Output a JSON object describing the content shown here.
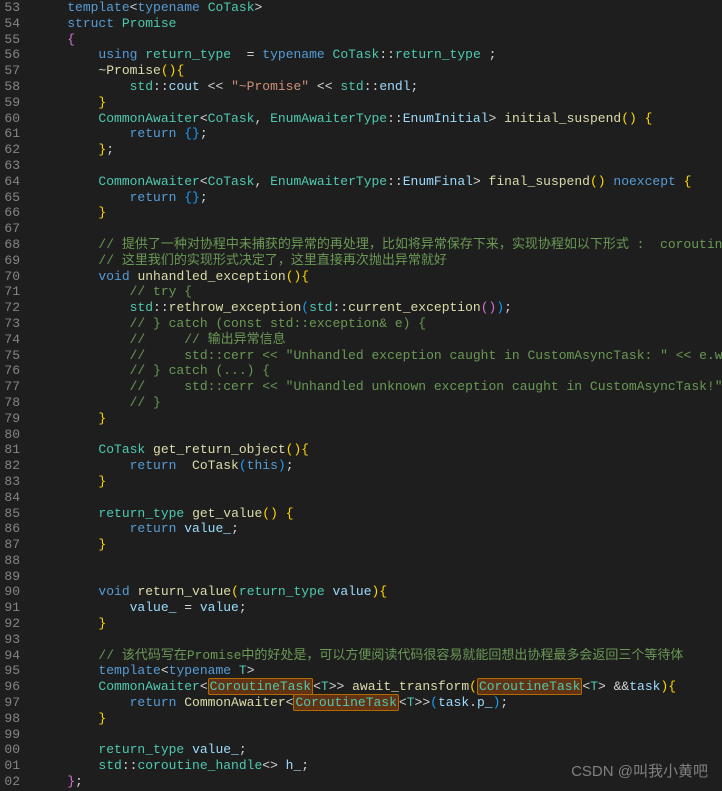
{
  "watermark": "CSDN @叫我小黄吧",
  "lines": [
    {
      "n": "53",
      "t": "    template<typename CoTask>",
      "tok": [
        [
          "    ",
          ""
        ],
        [
          "template",
          "kw"
        ],
        [
          "<",
          "op"
        ],
        [
          "typename",
          "kw"
        ],
        [
          " ",
          ""
        ],
        [
          "CoTask",
          "type"
        ],
        [
          ">",
          "op"
        ]
      ]
    },
    {
      "n": "54",
      "t": "    struct Promise",
      "tok": [
        [
          "    ",
          ""
        ],
        [
          "struct",
          "kw"
        ],
        [
          " ",
          ""
        ],
        [
          "Promise",
          "type"
        ]
      ]
    },
    {
      "n": "55",
      "t": "    {",
      "tok": [
        [
          "    ",
          ""
        ],
        [
          "{",
          "brace"
        ]
      ]
    },
    {
      "n": "56",
      "t": "        using return_type  = typename CoTask::return_type ;",
      "tok": [
        [
          "        ",
          ""
        ],
        [
          "using",
          "kw"
        ],
        [
          " ",
          ""
        ],
        [
          "return_type",
          "type"
        ],
        [
          "  = ",
          ""
        ],
        [
          "typename",
          "kw"
        ],
        [
          " ",
          ""
        ],
        [
          "CoTask",
          "type"
        ],
        [
          "::",
          ""
        ],
        [
          "return_type",
          "type"
        ],
        [
          " ;",
          ""
        ]
      ]
    },
    {
      "n": "57",
      "t": "        ~Promise(){",
      "tok": [
        [
          "        ~",
          ""
        ],
        [
          "Promise",
          "fn"
        ],
        [
          "()",
          "brace2"
        ],
        [
          "{",
          "brace2"
        ]
      ]
    },
    {
      "n": "58",
      "t": "            std::cout << \"~Promise\" << std::endl;",
      "tok": [
        [
          "            ",
          ""
        ],
        [
          "std",
          "type"
        ],
        [
          "::",
          ""
        ],
        [
          "cout",
          "var"
        ],
        [
          " << ",
          ""
        ],
        [
          "\"~Promise\"",
          "str"
        ],
        [
          " << ",
          ""
        ],
        [
          "std",
          "type"
        ],
        [
          "::",
          ""
        ],
        [
          "endl",
          "var"
        ],
        [
          ";",
          ""
        ]
      ]
    },
    {
      "n": "59",
      "t": "        }",
      "tok": [
        [
          "        ",
          ""
        ],
        [
          "}",
          "brace2"
        ]
      ]
    },
    {
      "n": "60",
      "t": "        CommonAwaiter<CoTask, EnumAwaiterType::EnumInitial> initial_suspend() {",
      "tok": [
        [
          "        ",
          ""
        ],
        [
          "CommonAwaiter",
          "type"
        ],
        [
          "<",
          "op"
        ],
        [
          "CoTask",
          "type"
        ],
        [
          ", ",
          ""
        ],
        [
          "EnumAwaiterType",
          "type"
        ],
        [
          "::",
          ""
        ],
        [
          "EnumInitial",
          "var"
        ],
        [
          "> ",
          ""
        ],
        [
          "initial_suspend",
          "fn"
        ],
        [
          "()",
          "brace2"
        ],
        [
          " ",
          ""
        ],
        [
          "{",
          "brace2"
        ]
      ]
    },
    {
      "n": "61",
      "t": "            return {};",
      "tok": [
        [
          "            ",
          ""
        ],
        [
          "return",
          "kw"
        ],
        [
          " ",
          ""
        ],
        [
          "{}",
          "brace3"
        ],
        [
          ";",
          ""
        ]
      ]
    },
    {
      "n": "62",
      "t": "        };",
      "tok": [
        [
          "        ",
          ""
        ],
        [
          "}",
          "brace2"
        ],
        [
          ";",
          ""
        ]
      ]
    },
    {
      "n": "63",
      "t": "",
      "tok": []
    },
    {
      "n": "64",
      "t": "        CommonAwaiter<CoTask, EnumAwaiterType::EnumFinal> final_suspend() noexcept {",
      "tok": [
        [
          "        ",
          ""
        ],
        [
          "CommonAwaiter",
          "type"
        ],
        [
          "<",
          "op"
        ],
        [
          "CoTask",
          "type"
        ],
        [
          ", ",
          ""
        ],
        [
          "EnumAwaiterType",
          "type"
        ],
        [
          "::",
          ""
        ],
        [
          "EnumFinal",
          "var"
        ],
        [
          "> ",
          ""
        ],
        [
          "final_suspend",
          "fn"
        ],
        [
          "()",
          "brace2"
        ],
        [
          " ",
          ""
        ],
        [
          "noexcept",
          "kw"
        ],
        [
          " ",
          ""
        ],
        [
          "{",
          "brace2"
        ]
      ]
    },
    {
      "n": "65",
      "t": "            return {};",
      "tok": [
        [
          "            ",
          ""
        ],
        [
          "return",
          "kw"
        ],
        [
          " ",
          ""
        ],
        [
          "{}",
          "brace3"
        ],
        [
          ";",
          ""
        ]
      ]
    },
    {
      "n": "66",
      "t": "        }",
      "tok": [
        [
          "        ",
          ""
        ],
        [
          "}",
          "brace2"
        ]
      ]
    },
    {
      "n": "67",
      "t": "",
      "tok": []
    },
    {
      "n": "68",
      "t": "        // 提供了一种对协程中未捕获的异常的再处理，比如将异常保存下来，实现协程如以下形式 :  coroutine().get().catch()",
      "tok": [
        [
          "        ",
          ""
        ],
        [
          "// 提供了一种对协程中未捕获的异常的再处理，比如将异常保存下来，实现协程如以下形式 :  coroutine().get().catch()",
          "cmt"
        ]
      ]
    },
    {
      "n": "69",
      "t": "        // 这里我们的实现形式决定了，这里直接再次抛出异常就好",
      "tok": [
        [
          "        ",
          ""
        ],
        [
          "// 这里我们的实现形式决定了，这里直接再次抛出异常就好",
          "cmt"
        ]
      ]
    },
    {
      "n": "70",
      "t": "        void unhandled_exception(){",
      "tok": [
        [
          "        ",
          ""
        ],
        [
          "void",
          "kw"
        ],
        [
          " ",
          ""
        ],
        [
          "unhandled_exception",
          "fn"
        ],
        [
          "()",
          "brace2"
        ],
        [
          "{",
          "brace2"
        ]
      ]
    },
    {
      "n": "71",
      "t": "            // try {",
      "tok": [
        [
          "            ",
          ""
        ],
        [
          "// try {",
          "cmt"
        ]
      ]
    },
    {
      "n": "72",
      "t": "            std::rethrow_exception(std::current_exception());",
      "tok": [
        [
          "            ",
          ""
        ],
        [
          "std",
          "type"
        ],
        [
          "::",
          ""
        ],
        [
          "rethrow_exception",
          "fn"
        ],
        [
          "(",
          "brace3"
        ],
        [
          "std",
          "type"
        ],
        [
          "::",
          ""
        ],
        [
          "current_exception",
          "fn"
        ],
        [
          "()",
          "brace"
        ],
        [
          ")",
          "brace3"
        ],
        [
          ";",
          ""
        ]
      ]
    },
    {
      "n": "73",
      "t": "            // } catch (const std::exception& e) {",
      "tok": [
        [
          "            ",
          ""
        ],
        [
          "// } catch (const std::exception& e) {",
          "cmt"
        ]
      ]
    },
    {
      "n": "74",
      "t": "            //     // 输出异常信息",
      "tok": [
        [
          "            ",
          ""
        ],
        [
          "//     // 输出异常信息",
          "cmt"
        ]
      ]
    },
    {
      "n": "75",
      "t": "            //     std::cerr << \"Unhandled exception caught in CustomAsyncTask: \" << e.what() << std::endl;",
      "tok": [
        [
          "            ",
          ""
        ],
        [
          "//     std::cerr << \"Unhandled exception caught in CustomAsyncTask: \" << e.what() << std::endl;",
          "cmt"
        ]
      ]
    },
    {
      "n": "76",
      "t": "            // } catch (...) {",
      "tok": [
        [
          "            ",
          ""
        ],
        [
          "// } catch (...) {",
          "cmt"
        ]
      ]
    },
    {
      "n": "77",
      "t": "            //     std::cerr << \"Unhandled unknown exception caught in CustomAsyncTask!\" << std::endl;",
      "tok": [
        [
          "            ",
          ""
        ],
        [
          "//     std::cerr << \"Unhandled unknown exception caught in CustomAsyncTask!\" << std::endl;",
          "cmt"
        ]
      ]
    },
    {
      "n": "78",
      "t": "            // }",
      "tok": [
        [
          "            ",
          ""
        ],
        [
          "// }",
          "cmt"
        ]
      ]
    },
    {
      "n": "79",
      "t": "        }",
      "tok": [
        [
          "        ",
          ""
        ],
        [
          "}",
          "brace2"
        ]
      ]
    },
    {
      "n": "80",
      "t": "",
      "tok": []
    },
    {
      "n": "81",
      "t": "        CoTask get_return_object(){",
      "tok": [
        [
          "        ",
          ""
        ],
        [
          "CoTask",
          "type"
        ],
        [
          " ",
          ""
        ],
        [
          "get_return_object",
          "fn"
        ],
        [
          "()",
          "brace2"
        ],
        [
          "{",
          "brace2"
        ]
      ]
    },
    {
      "n": "82",
      "t": "            return  CoTask(this);",
      "tok": [
        [
          "            ",
          ""
        ],
        [
          "return",
          "kw"
        ],
        [
          "  ",
          ""
        ],
        [
          "CoTask",
          "fn"
        ],
        [
          "(",
          "brace3"
        ],
        [
          "this",
          "kw"
        ],
        [
          ")",
          "brace3"
        ],
        [
          ";",
          ""
        ]
      ]
    },
    {
      "n": "83",
      "t": "        }",
      "tok": [
        [
          "        ",
          ""
        ],
        [
          "}",
          "brace2"
        ]
      ]
    },
    {
      "n": "84",
      "t": "",
      "tok": []
    },
    {
      "n": "85",
      "t": "        return_type get_value() {",
      "tok": [
        [
          "        ",
          ""
        ],
        [
          "return_type",
          "type"
        ],
        [
          " ",
          ""
        ],
        [
          "get_value",
          "fn"
        ],
        [
          "()",
          "brace2"
        ],
        [
          " ",
          ""
        ],
        [
          "{",
          "brace2"
        ]
      ]
    },
    {
      "n": "86",
      "t": "            return value_;",
      "tok": [
        [
          "            ",
          ""
        ],
        [
          "return",
          "kw"
        ],
        [
          " ",
          ""
        ],
        [
          "value_",
          "var"
        ],
        [
          ";",
          ""
        ]
      ]
    },
    {
      "n": "87",
      "t": "        }",
      "tok": [
        [
          "        ",
          ""
        ],
        [
          "}",
          "brace2"
        ]
      ]
    },
    {
      "n": "88",
      "t": "",
      "tok": []
    },
    {
      "n": "89",
      "t": "",
      "tok": []
    },
    {
      "n": "90",
      "t": "        void return_value(return_type value){",
      "tok": [
        [
          "        ",
          ""
        ],
        [
          "void",
          "kw"
        ],
        [
          " ",
          ""
        ],
        [
          "return_value",
          "fn"
        ],
        [
          "(",
          "brace2"
        ],
        [
          "return_type",
          "type"
        ],
        [
          " ",
          ""
        ],
        [
          "value",
          "var"
        ],
        [
          ")",
          "brace2"
        ],
        [
          "{",
          "brace2"
        ]
      ]
    },
    {
      "n": "91",
      "t": "            value_ = value;",
      "tok": [
        [
          "            ",
          ""
        ],
        [
          "value_",
          "var"
        ],
        [
          " = ",
          ""
        ],
        [
          "value",
          "var"
        ],
        [
          ";",
          ""
        ]
      ]
    },
    {
      "n": "92",
      "t": "        }",
      "tok": [
        [
          "        ",
          ""
        ],
        [
          "}",
          "brace2"
        ]
      ]
    },
    {
      "n": "93",
      "t": "",
      "tok": []
    },
    {
      "n": "94",
      "t": "        // 该代码写在Promise中的好处是，可以方便阅读代码很容易就能回想出协程最多会返回三个等待体",
      "tok": [
        [
          "        ",
          ""
        ],
        [
          "// 该代码写在Promise中的好处是，可以方便阅读代码很容易就能回想出协程最多会返回三个等待体",
          "cmt"
        ]
      ]
    },
    {
      "n": "95",
      "t": "        template<typename T>",
      "tok": [
        [
          "        ",
          ""
        ],
        [
          "template",
          "kw"
        ],
        [
          "<",
          "op"
        ],
        [
          "typename",
          "kw"
        ],
        [
          " ",
          ""
        ],
        [
          "T",
          "type"
        ],
        [
          ">",
          "op"
        ]
      ]
    },
    {
      "n": "96",
      "t": "        CommonAwaiter<CoroutineTask<T>> await_transform(CoroutineTask<T> &&task){",
      "tok": [
        [
          "        ",
          ""
        ],
        [
          "CommonAwaiter",
          "type"
        ],
        [
          "<",
          "op"
        ],
        [
          "CoroutineTask",
          "type hl"
        ],
        [
          "<",
          "op"
        ],
        [
          "T",
          "type"
        ],
        [
          ">> ",
          ""
        ],
        [
          "await_transform",
          "fn"
        ],
        [
          "(",
          "brace2"
        ],
        [
          "CoroutineTask",
          "type hl"
        ],
        [
          "<",
          "op"
        ],
        [
          "T",
          "type"
        ],
        [
          "> &&",
          ""
        ],
        [
          "task",
          "var"
        ],
        [
          ")",
          "brace2"
        ],
        [
          "{",
          "brace2"
        ]
      ]
    },
    {
      "n": "97",
      "t": "            return CommonAwaiter<CoroutineTask<T>>(task.p_);",
      "tok": [
        [
          "            ",
          ""
        ],
        [
          "return",
          "kw"
        ],
        [
          " ",
          ""
        ],
        [
          "CommonAwaiter",
          "fn"
        ],
        [
          "<",
          "op"
        ],
        [
          "CoroutineTask",
          "type hl"
        ],
        [
          "<",
          "op"
        ],
        [
          "T",
          "type"
        ],
        [
          ">>",
          ""
        ],
        [
          "(",
          "brace3"
        ],
        [
          "task",
          "var"
        ],
        [
          ".",
          ""
        ],
        [
          "p_",
          "var"
        ],
        [
          ")",
          "brace3"
        ],
        [
          ";",
          ""
        ]
      ]
    },
    {
      "n": "98",
      "t": "        }",
      "tok": [
        [
          "        ",
          ""
        ],
        [
          "}",
          "brace2"
        ]
      ]
    },
    {
      "n": "99",
      "t": "",
      "tok": []
    },
    {
      "n": "00",
      "t": "        return_type value_;",
      "tok": [
        [
          "        ",
          ""
        ],
        [
          "return_type",
          "type"
        ],
        [
          " ",
          ""
        ],
        [
          "value_",
          "var"
        ],
        [
          ";",
          ""
        ]
      ]
    },
    {
      "n": "01",
      "t": "        std::coroutine_handle<> h_;",
      "tok": [
        [
          "        ",
          ""
        ],
        [
          "std",
          "type"
        ],
        [
          "::",
          ""
        ],
        [
          "coroutine_handle",
          "type"
        ],
        [
          "<> ",
          ""
        ],
        [
          "h_",
          "var"
        ],
        [
          ";",
          ""
        ]
      ]
    },
    {
      "n": "02",
      "t": "    };",
      "tok": [
        [
          "    ",
          ""
        ],
        [
          "}",
          "brace"
        ],
        [
          ";",
          ""
        ]
      ]
    }
  ]
}
